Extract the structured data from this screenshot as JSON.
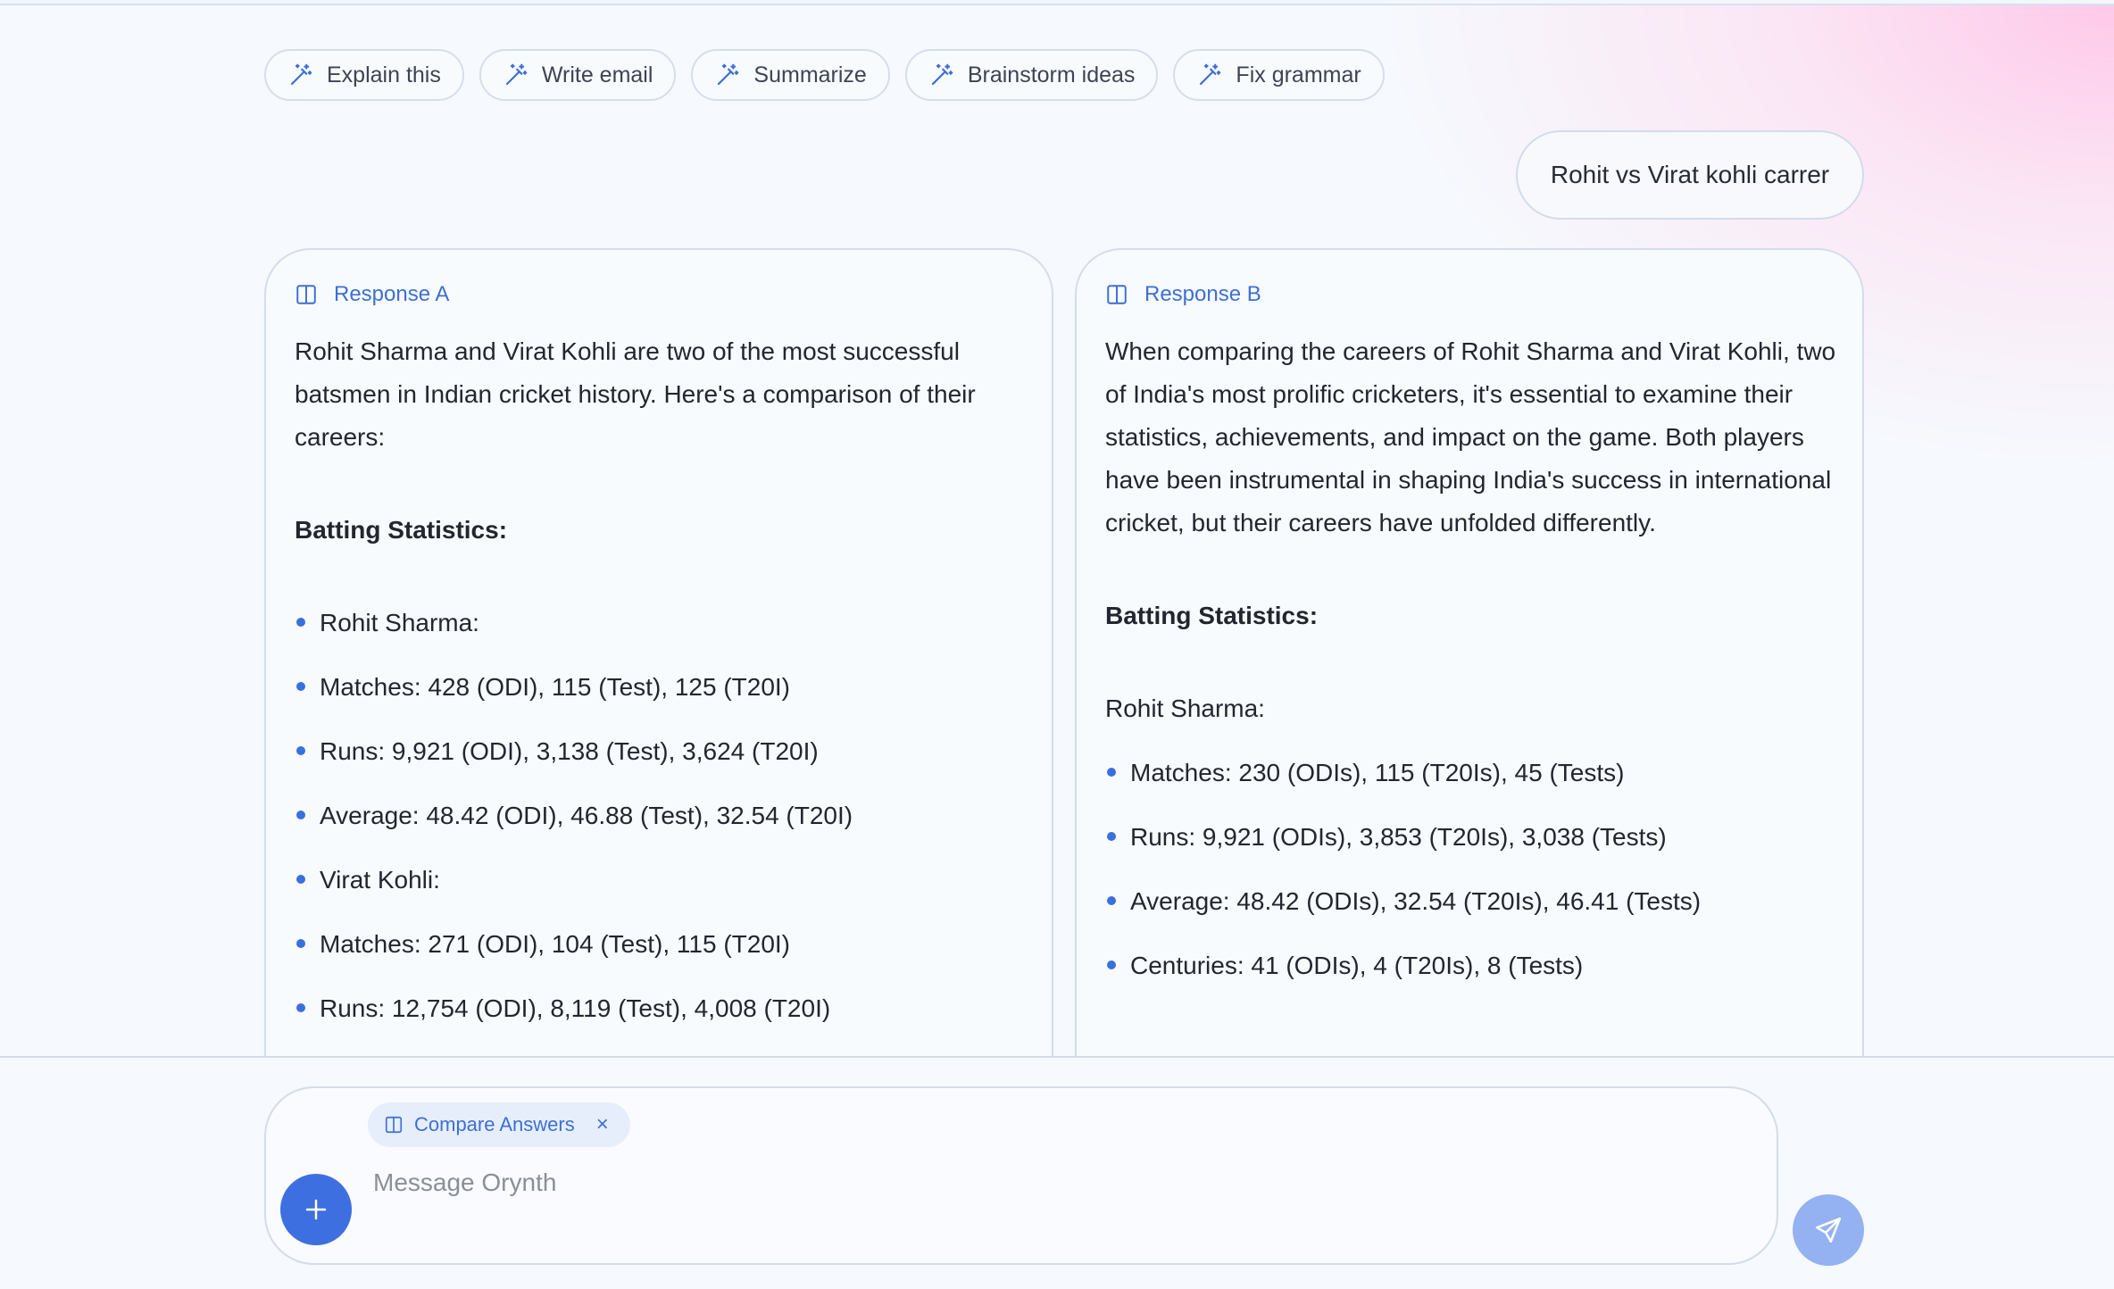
{
  "suggestions": [
    {
      "label": "Explain this",
      "icon": "magic-wand-icon"
    },
    {
      "label": "Write email",
      "icon": "magic-wand-icon"
    },
    {
      "label": "Summarize",
      "icon": "magic-wand-icon"
    },
    {
      "label": "Brainstorm ideas",
      "icon": "magic-wand-icon"
    },
    {
      "label": "Fix grammar",
      "icon": "magic-wand-icon"
    }
  ],
  "user_message": "Rohit vs Virat kohli carrer",
  "response_a": {
    "title": "Response A",
    "icon": "columns-icon",
    "intro": "Rohit Sharma and Virat Kohli are two of the most successful batsmen in Indian cricket history. Here's a comparison of their careers:",
    "heading": "Batting Statistics:",
    "bullets": [
      "Rohit Sharma:",
      "Matches: 428 (ODI), 115 (Test), 125 (T20I)",
      "Runs: 9,921 (ODI), 3,138 (Test), 3,624 (T20I)",
      "Average: 48.42 (ODI), 46.88 (Test), 32.54 (T20I)",
      "Virat Kohli:",
      "Matches: 271 (ODI), 104 (Test), 115 (T20I)",
      "Runs: 12,754 (ODI), 8,119 (Test), 4,008 (T20I)"
    ]
  },
  "response_b": {
    "title": "Response B",
    "icon": "columns-icon",
    "intro": "When comparing the careers of Rohit Sharma and Virat Kohli, two of India's most prolific cricketers, it's essential to examine their statistics, achievements, and impact on the game. Both players have been instrumental in shaping India's success in international cricket, but their careers have unfolded differently.",
    "heading": "Batting Statistics:",
    "subheading": "Rohit Sharma:",
    "bullets": [
      "Matches: 230 (ODIs), 115 (T20Is), 45 (Tests)",
      "Runs: 9,921 (ODIs), 3,853 (T20Is), 3,038 (Tests)",
      "Average: 48.42 (ODIs), 32.54 (T20Is), 46.41 (Tests)",
      "Centuries: 41 (ODIs), 4 (T20Is), 8 (Tests)"
    ]
  },
  "composer": {
    "tag_label": "Compare Answers",
    "tag_close": "×",
    "placeholder": "Message Orynth"
  },
  "colors": {
    "accent": "#3e6fe0",
    "send_disabled": "#94b1f2",
    "background": "#f6f9fd"
  }
}
